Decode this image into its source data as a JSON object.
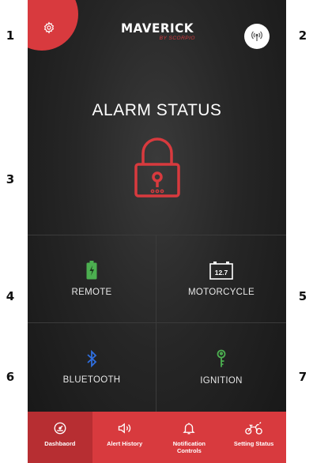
{
  "callouts": [
    "1",
    "2",
    "3",
    "4",
    "5",
    "6",
    "7"
  ],
  "header": {
    "logo_brand": "MAVERICK",
    "logo_byline": "BY SCORPIO",
    "settings_icon": "gear-icon",
    "signal_icon": "signal-antenna-icon"
  },
  "alarm": {
    "title": "ALARM STATUS",
    "lock_icon": "padlock-icon",
    "lock_color": "#d83a3e"
  },
  "status_grid": [
    {
      "label": "REMOTE",
      "icon": "battery-icon",
      "color": "#4caf50"
    },
    {
      "label": "MOTORCYCLE",
      "icon": "motorcycle-battery-icon",
      "value": "12.7",
      "color": "#ffffff"
    },
    {
      "label": "BLUETOOTH",
      "icon": "bluetooth-icon",
      "color": "#2f6fe0"
    },
    {
      "label": "IGNITION",
      "icon": "key-icon",
      "color": "#4caf50"
    }
  ],
  "tabs": [
    {
      "label": "Dashbaord",
      "icon": "speedometer-icon",
      "active": true
    },
    {
      "label": "Alert History",
      "icon": "speaker-icon",
      "active": false
    },
    {
      "label": "Notification Controls",
      "icon": "bell-icon",
      "active": false
    },
    {
      "label": "Setting Status",
      "icon": "motorcycle-icon",
      "active": false
    }
  ],
  "colors": {
    "accent": "#d83a3e",
    "background": "#262626"
  }
}
